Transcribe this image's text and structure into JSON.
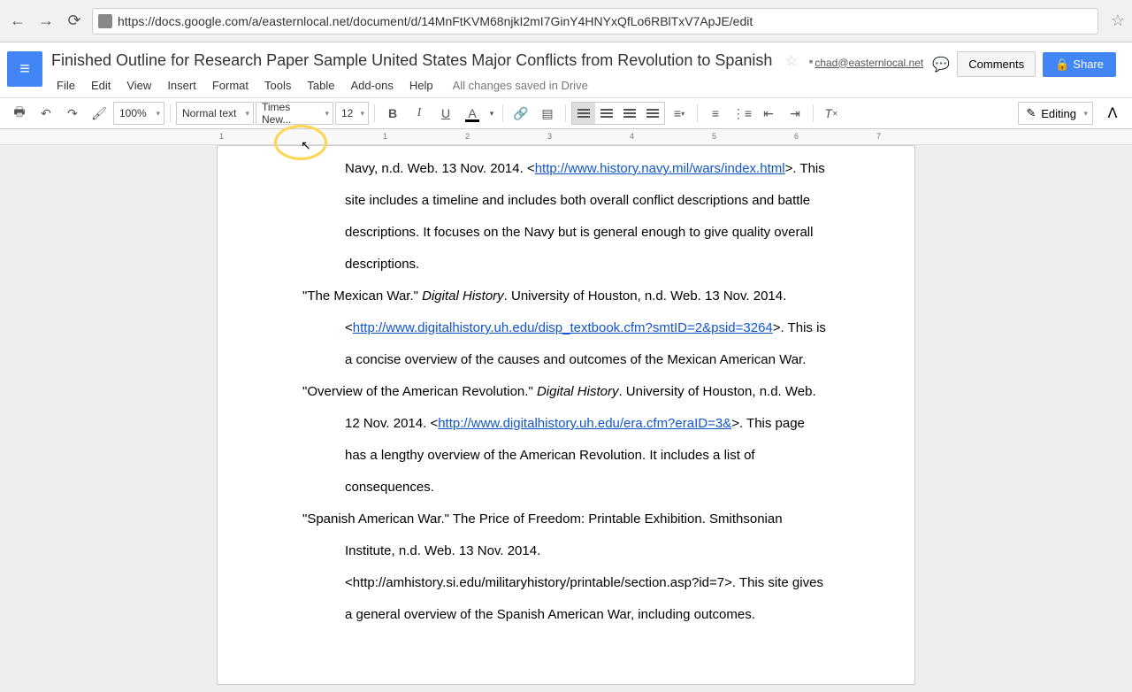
{
  "browser": {
    "url": "https://docs.google.com/a/easternlocal.net/document/d/14MnFtKVM68njkI2mI7GinY4HNYxQfLo6RBlTxV7ApJE/edit"
  },
  "header": {
    "doc_title": "Finished Outline for Research Paper Sample United States Major Conflicts from Revolution to Spanish",
    "user_email": "chad@easternlocal.net",
    "comments_label": "Comments",
    "share_label": "Share",
    "save_status": "All changes saved in Drive"
  },
  "menu": {
    "file": "File",
    "edit": "Edit",
    "view": "View",
    "insert": "Insert",
    "format": "Format",
    "tools": "Tools",
    "table": "Table",
    "addons": "Add-ons",
    "help": "Help"
  },
  "toolbar": {
    "zoom": "100%",
    "style": "Normal text",
    "font": "Times New...",
    "size": "12",
    "editing_label": "Editing"
  },
  "ruler": {
    "ticks": [
      "1",
      "1",
      "2",
      "3",
      "4",
      "5",
      "6",
      "7"
    ]
  },
  "content": {
    "frag_line1": "Navy, n.d. Web. 13 Nov. 2014. <",
    "frag_link1": "http://www.history.navy.mil/wars/index.html",
    "frag_line1b": ">. This site includes a timeline and includes both overall conflict descriptions and battle descriptions. It focuses on the Navy but is general enough to give quality overall descriptions.",
    "e2_a": "\"The Mexican War.\" ",
    "e2_i": "Digital History",
    "e2_b": ". University of Houston, n.d. Web. 13 Nov. 2014. <",
    "e2_link": "http://www.digitalhistory.uh.edu/disp_textbook.cfm?smtID=2&psid=3264",
    "e2_c": ">. This is a concise overview of the causes and outcomes of the Mexican American War.",
    "e3_a": "\"Overview of the American Revolution.\" ",
    "e3_i": "Digital History",
    "e3_b": ". University of Houston, n.d. Web. 12 Nov. 2014. <",
    "e3_link": "http://www.digitalhistory.uh.edu/era.cfm?eraID=3&",
    "e3_c": ">. This page has a lengthy overview of the American Revolution. It includes a list of consequences.",
    "e4_a": "\"Spanish American War.\" The Price of Freedom: Printable Exhibition. Smithsonian Institute, n.d. Web. 13 Nov. 2014.<http://amhistory.si.edu/militaryhistory/printable/section.asp?id=7>. This site gives a general overview of the Spanish American War, including outcomes."
  }
}
